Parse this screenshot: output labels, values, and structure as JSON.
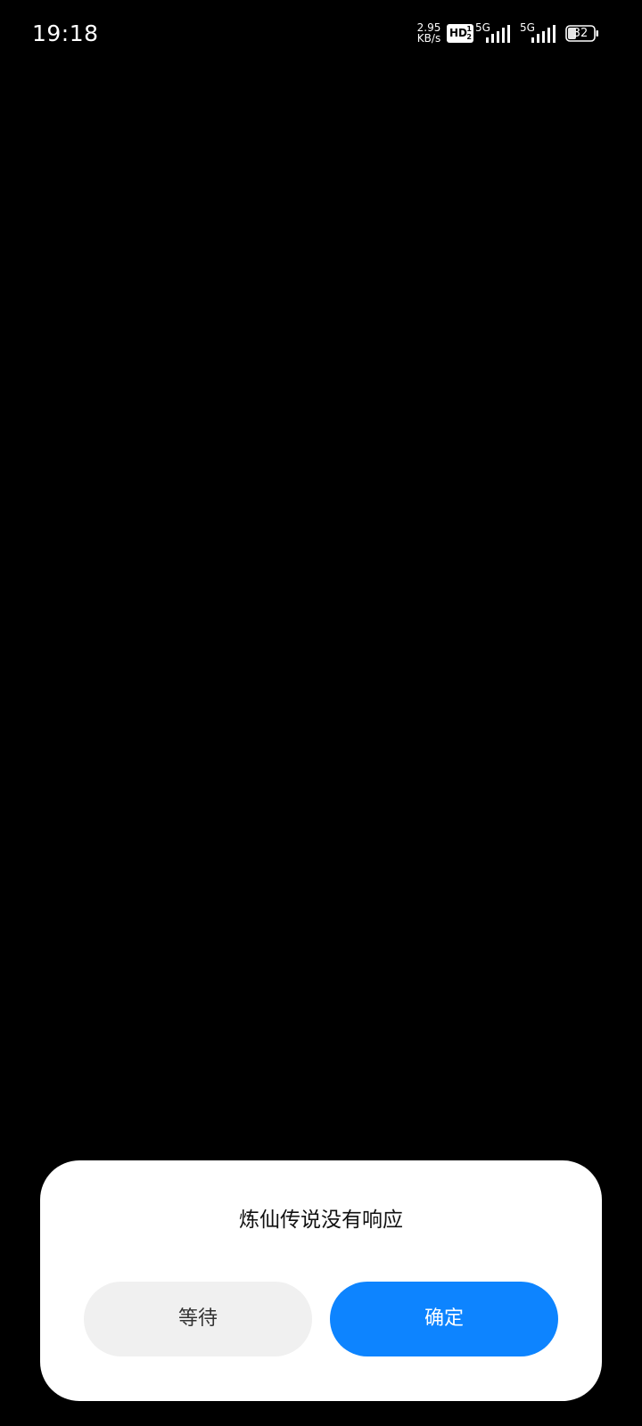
{
  "status_bar": {
    "time": "19:18",
    "net_speed_value": "2.95",
    "net_speed_unit": "KB/s",
    "hd_label": "HD",
    "hd_fraction_top": "1",
    "hd_fraction_bottom": "2",
    "sim1_network": "5G",
    "sim2_network": "5G",
    "battery_level": "32",
    "icons": [
      "signal-icon",
      "signal-icon",
      "battery-icon"
    ]
  },
  "dialog": {
    "title": "炼仙传说没有响应",
    "wait_label": "等待",
    "ok_label": "确定"
  },
  "colors": {
    "background": "#000000",
    "dialog_bg": "#ffffff",
    "primary_button": "#0d84ff",
    "secondary_button": "#f0f0f0"
  }
}
